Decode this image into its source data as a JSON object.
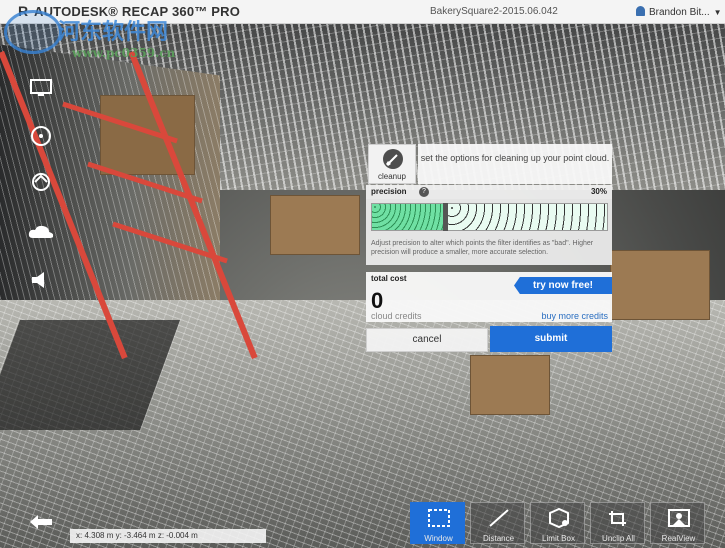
{
  "app": {
    "brand": "AUTODESK® RECAP 360™ PRO",
    "logo_letter": "R",
    "project_name": "BakerySquare2-2015.06.042",
    "user_name": "Brandon Bit...",
    "user_menu_caret": "▼"
  },
  "watermark": {
    "title": "河东软件网",
    "url": "www.pc0359.cn"
  },
  "left_toolbar": {
    "icons": [
      "monitor-icon",
      "target-icon",
      "orbit-icon",
      "cloud-icon",
      "speaker-icon"
    ]
  },
  "cleanup_dialog": {
    "cleanup_label": "cleanup",
    "title": "set the options for cleaning up your point cloud.",
    "precision_label": "precision",
    "precision_value": "30%",
    "precision_fraction": 0.3,
    "help_glyph": "?",
    "hint": "Adjust precision to alter which points the filter identifies as \"bad\". Higher precision will produce a smaller, more accurate selection.",
    "total_cost_label": "total cost",
    "try_button": "try now free!",
    "cost_value": "0",
    "credits_label": "cloud credits",
    "buy_link": "buy more credits",
    "cancel_button": "cancel",
    "submit_button": "submit"
  },
  "status": {
    "coords": "x: 4.308  m   y: -3.464  m   z: -0.004  m"
  },
  "tools": [
    {
      "label": "Window",
      "icon": "window-select-icon",
      "active": true
    },
    {
      "label": "Distance",
      "icon": "distance-icon",
      "active": false
    },
    {
      "label": "Limit Box",
      "icon": "limit-box-icon",
      "active": false
    },
    {
      "label": "Unclip All",
      "icon": "unclip-icon",
      "active": false
    },
    {
      "label": "RealView",
      "icon": "realview-icon",
      "active": false
    }
  ],
  "colors": {
    "accent": "#1f6fd8",
    "ladder": "#d9483b"
  }
}
